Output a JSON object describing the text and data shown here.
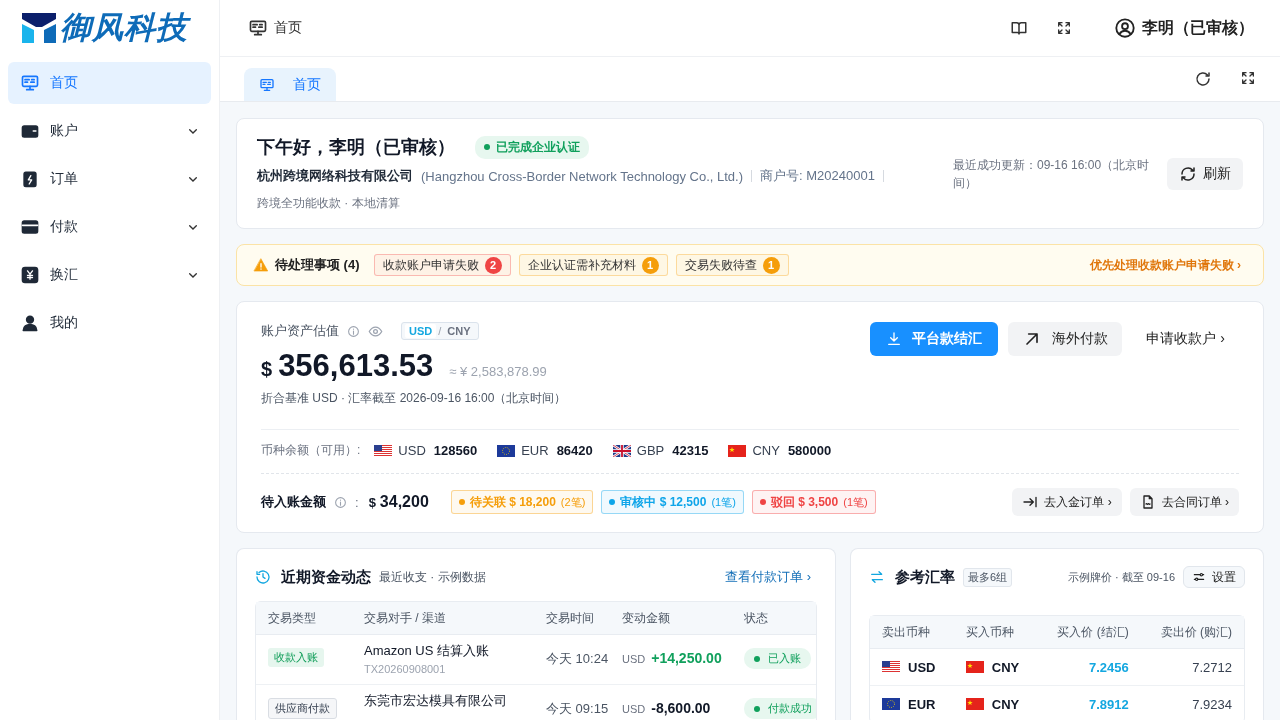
{
  "logo": {
    "text": "御风科技"
  },
  "sidebar": {
    "items": [
      {
        "label": "首页",
        "selected": true
      },
      {
        "label": "账户",
        "selected": false,
        "expanded": false
      },
      {
        "label": "订单",
        "selected": false,
        "expanded": false
      },
      {
        "label": "付款",
        "selected": false,
        "expanded": false
      },
      {
        "label": "换汇",
        "selected": false,
        "expanded": false
      },
      {
        "label": "我的",
        "selected": false
      }
    ]
  },
  "header": {
    "breadcrumb": "首页",
    "user": "李明（已审核）"
  },
  "tabs": [
    {
      "label": "首页",
      "selected": true
    }
  ],
  "welcome": {
    "greeting": "下午好，李明（已审核）",
    "badge": "已完成企业认证",
    "company": "杭州跨境网络科技有限公司",
    "company_en": "(Hangzhou Cross-Border Network Technology Co., Ltd.)",
    "merchant_id": "商户号: M20240001",
    "services": "跨境全功能收款 · 本地清算",
    "updated": "最近成功更新：09-16 16:00（北京时间）",
    "refresh": "刷新"
  },
  "pending": {
    "title": "待处理事项 (4)",
    "items": [
      {
        "label": "收款账户申请失败",
        "count": "2",
        "color": "#ef4444"
      },
      {
        "label": "企业认证需补充材料",
        "count": "1",
        "color": "#f59e0b"
      },
      {
        "label": "交易失败待查",
        "count": "1",
        "color": "#f59e0b"
      }
    ],
    "action": "优先处理收款账户申请失败 ›"
  },
  "assets": {
    "label": "账户资产估值",
    "currency_toggle": [
      {
        "label": "USD",
        "selected": true
      },
      {
        "label": "CNY",
        "selected": false
      }
    ],
    "toggle_separator": "/",
    "symbol": "$",
    "total": "356,613.53",
    "approx": "≈ ¥ 2,583,878.99",
    "basis": "折合基准 USD · 汇率截至 2026-09-16 16:00（北京时间）",
    "buttons": [
      {
        "label": "平台款结汇",
        "kind": "primary"
      },
      {
        "label": "海外付款",
        "kind": "secondary"
      },
      {
        "label": "申请收款户 ›",
        "kind": "link"
      }
    ],
    "balances_label": "币种余额（可用）:",
    "balances": [
      {
        "currency": "USD",
        "amount": "128560",
        "kind": "us"
      },
      {
        "currency": "EUR",
        "amount": "86420",
        "kind": "eu"
      },
      {
        "currency": "GBP",
        "amount": "42315",
        "kind": "gb"
      },
      {
        "currency": "CNY",
        "amount": "580000",
        "kind": "cn"
      }
    ],
    "incoming_label": "待入账金额",
    "incoming_separator": ":",
    "incoming_symbol": "$",
    "incoming_amount": "34,200",
    "incoming_tags": [
      {
        "label": "待关联",
        "amount": "$ 18,200",
        "count": "(2笔)",
        "color": "#f59e0b"
      },
      {
        "label": "审核中",
        "amount": "$ 12,500",
        "count": "(1笔)",
        "color": "#0ea5e9"
      },
      {
        "label": "驳回",
        "amount": "$ 3,500",
        "count": "(1笔)",
        "color": "#ef4444"
      }
    ],
    "links": [
      {
        "label": "去入金订单 ›",
        "kind": "deposit"
      },
      {
        "label": "去合同订单 ›",
        "kind": "contract"
      }
    ]
  },
  "transactions": {
    "title": "近期资金动态",
    "subtitle": "最近收支 · 示例数据",
    "link": "查看付款订单 ›",
    "columns": [
      "交易类型",
      "交易对手 / 渠道",
      "交易时间",
      "变动金额",
      "状态"
    ],
    "rows": [
      {
        "kind": "income",
        "type": "收款入账",
        "counterparty": "Amazon US 结算入账",
        "reference": "TX20260908001",
        "time": "今天 10:24",
        "currency": "USD",
        "amount": "+14,250.00",
        "status": "已入账"
      },
      {
        "kind": "payment",
        "type": "供应商付款",
        "counterparty": "东莞市宏达模具有限公司",
        "time": "今天 09:15",
        "currency": "USD",
        "amount": "-8,600.00",
        "status": "付款成功"
      }
    ]
  },
  "rates": {
    "title": "参考汇率",
    "badge": "最多6组",
    "note": "示例牌价 · 截至 09-16",
    "settings": "设置",
    "columns": [
      "卖出币种",
      "买入币种",
      "买入价 (结汇)",
      "卖出价 (购汇)"
    ],
    "rows": [
      {
        "sell": {
          "currency": "USD",
          "kind": "us"
        },
        "buy": {
          "currency": "CNY",
          "kind": "cn"
        },
        "bid": "7.2456",
        "ask": "7.2712"
      },
      {
        "sell": {
          "currency": "EUR",
          "kind": "eu"
        },
        "buy": {
          "currency": "CNY",
          "kind": "cn"
        },
        "bid": "7.8912",
        "ask": "7.9234"
      }
    ]
  }
}
